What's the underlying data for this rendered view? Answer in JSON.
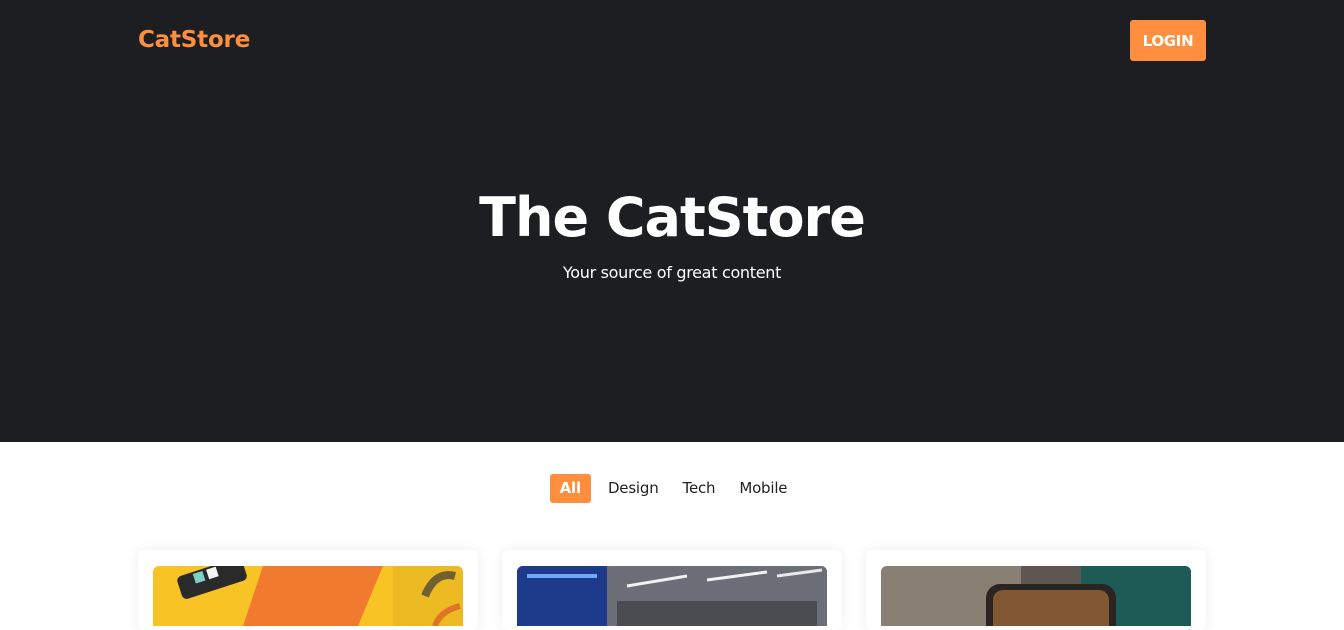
{
  "header": {
    "brand": "CatStore",
    "login_label": "LOGIN"
  },
  "hero": {
    "title": "The CatStore",
    "subtitle": "Your source of great content"
  },
  "filters": [
    {
      "label": "All",
      "active": true
    },
    {
      "label": "Design",
      "active": false
    },
    {
      "label": "Tech",
      "active": false
    },
    {
      "label": "Mobile",
      "active": false
    }
  ],
  "colors": {
    "accent": "#ff8f3e",
    "hero_background": "#1c1e22",
    "page_background": "#ffffff"
  }
}
